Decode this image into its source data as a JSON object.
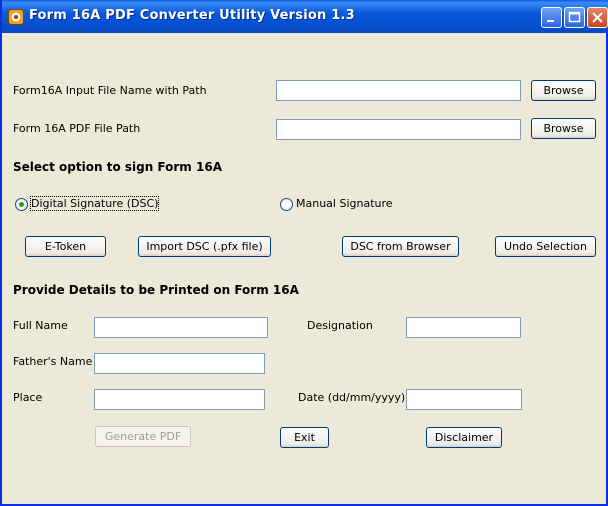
{
  "window": {
    "title": "Form 16A PDF Converter Utility Version 1.3"
  },
  "inputs": {
    "input_file_label": "Form16A Input File Name with Path",
    "input_file_value": "",
    "pdf_path_label": "Form 16A PDF File Path",
    "pdf_path_value": "",
    "browse_label": "Browse"
  },
  "sign": {
    "heading": "Select option to sign Form 16A",
    "option_dsc": "Digital Signature (DSC)",
    "option_manual": "Manual Signature",
    "selected": "dsc",
    "btn_etoken": "E-Token",
    "btn_import": "Import DSC (.pfx file)",
    "btn_browser": "DSC from Browser",
    "btn_undo": "Undo Selection"
  },
  "details": {
    "heading": "Provide Details to be Printed on Form 16A",
    "full_name_label": "Full Name",
    "designation_label": "Designation",
    "fathers_name_label": "Father's Name",
    "place_label": "Place",
    "date_label": "Date (dd/mm/yyyy)",
    "full_name_value": "",
    "designation_value": "",
    "fathers_name_value": "",
    "place_value": "",
    "date_value": ""
  },
  "actions": {
    "generate": "Generate PDF",
    "exit": "Exit",
    "disclaimer": "Disclaimer"
  },
  "colors": {
    "titlebar": "#0a58d8",
    "background": "#ece9d8",
    "radio_selected": "#21a121"
  }
}
